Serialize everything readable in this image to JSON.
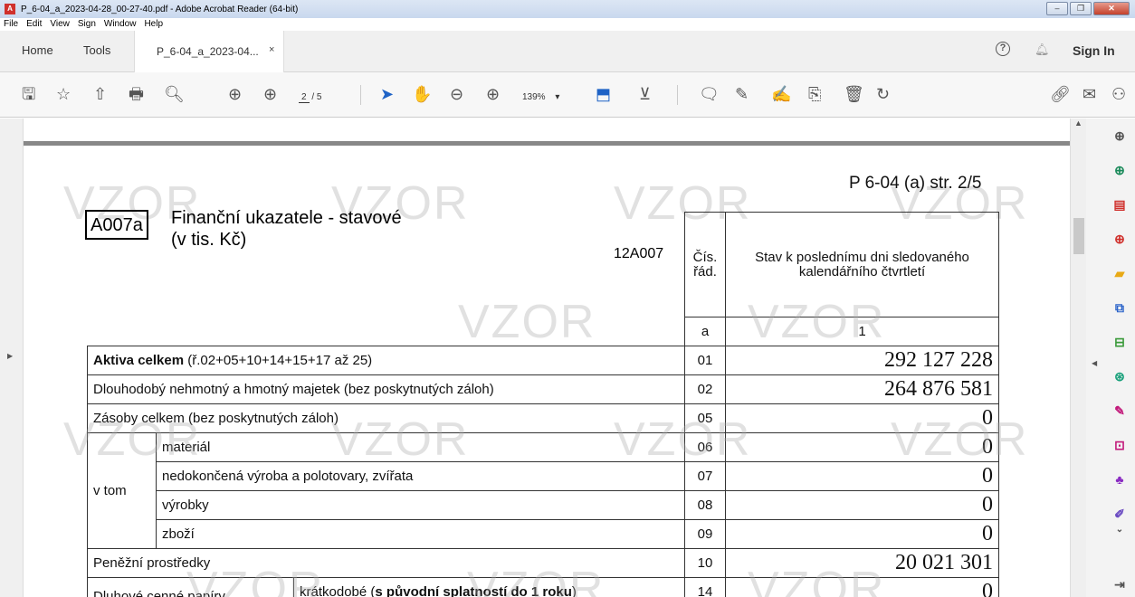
{
  "window": {
    "title": "P_6-04_a_2023-04-28_00-27-40.pdf - Adobe Acrobat Reader (64-bit)",
    "buttons": {
      "minimize": "‒",
      "restore": "❐",
      "close": "✕"
    }
  },
  "menu": [
    "File",
    "Edit",
    "View",
    "Sign",
    "Window",
    "Help"
  ],
  "tabs": {
    "home": "Home",
    "tools": "Tools",
    "doc": "P_6-04_a_2023-04...",
    "doc_close": "×",
    "help": "?",
    "signin": "Sign In"
  },
  "toolbar": {
    "page_current": "2",
    "page_total": "/ 5",
    "zoom": "139%",
    "zoom_caret": "▾"
  },
  "document": {
    "page_ref": "P 6-04 (a) str. 2/5",
    "section_code": "A007a",
    "title_line1": "Finanční ukazatele - stavové",
    "title_line2": "(v tis. Kč)",
    "table_code": "12A007",
    "watermark": "VZOR",
    "header": {
      "col_num": "Čís. řád.",
      "col_val": "Stav k poslednímu dni sledovaného kalendářního čtvrtletí",
      "sub_num": "a",
      "sub_val": "1"
    },
    "rows": [
      {
        "label_bold": "Aktiva celkem",
        "label": " (ř.02+05+10+14+15+17 až 25)",
        "num": "01",
        "value": "292 127 228"
      },
      {
        "label": "Dlouhodobý nehmotný a hmotný majetek (bez poskytnutých záloh)",
        "num": "02",
        "value": "264 876 581"
      },
      {
        "label": "Zásoby celkem (bez poskytnutých záloh)",
        "num": "05",
        "value": "0"
      },
      {
        "group": "v tom",
        "label": "materiál",
        "num": "06",
        "value": "0"
      },
      {
        "label": "nedokončená výroba a polotovary, zvířata",
        "num": "07",
        "value": "0"
      },
      {
        "label": "výrobky",
        "num": "08",
        "value": "0"
      },
      {
        "label": "zboží",
        "num": "09",
        "value": "0"
      },
      {
        "label": "Peněžní prostředky",
        "num": "10",
        "value": "20 021 301"
      },
      {
        "group": "Dluhové cenné papíry",
        "label_pre": "krátkodobé (",
        "label_bold": "s původní splatností do 1 roku",
        "label_post": ")",
        "num": "14",
        "value": "0"
      }
    ]
  }
}
